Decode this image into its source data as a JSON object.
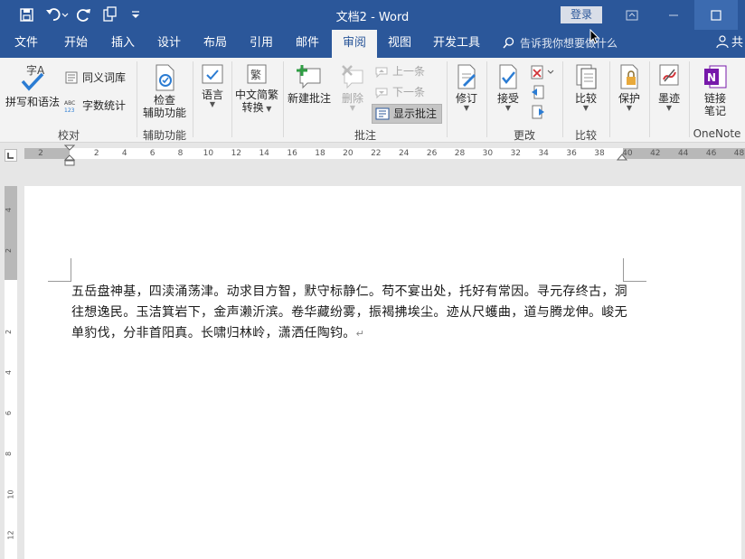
{
  "titlebar": {
    "title": "文档2  -  Word",
    "login": "登录",
    "qat": [
      "save-icon",
      "undo-icon",
      "redo-icon",
      "touch-mode-icon",
      "customize-qat-icon"
    ]
  },
  "tabs": [
    {
      "label": "文件"
    },
    {
      "label": "开始"
    },
    {
      "label": "插入"
    },
    {
      "label": "设计"
    },
    {
      "label": "布局"
    },
    {
      "label": "引用"
    },
    {
      "label": "邮件"
    },
    {
      "label": "审阅"
    },
    {
      "label": "视图"
    },
    {
      "label": "开发工具"
    }
  ],
  "tell_me": "告诉我你想要做什么",
  "share": "共",
  "ribbon": {
    "proofing": {
      "spelling": "拼写和语法",
      "thesaurus": "同义词库",
      "word_count": "字数统计",
      "group": "校对"
    },
    "accessibility": {
      "check_line1": "检查",
      "check_line2": "辅助功能",
      "group": "辅助功能"
    },
    "language": {
      "label": "语言"
    },
    "chinese": {
      "line1": "中文简繁",
      "line2": "转换"
    },
    "comments": {
      "new": "新建批注",
      "delete": "删除",
      "previous": "上一条",
      "next": "下一条",
      "show": "显示批注",
      "group": "批注"
    },
    "tracking": {
      "label": "修订"
    },
    "changes": {
      "accept": "接受",
      "group": "更改"
    },
    "compare": {
      "label": "比较",
      "group": "比较"
    },
    "protect": {
      "label": "保护"
    },
    "ink": {
      "label": "墨迹"
    },
    "onenote": {
      "line1": "链接",
      "line2": "笔记",
      "group": "OneNote"
    }
  },
  "ruler": {
    "h_ticks": [
      "2",
      "",
      "2",
      "4",
      "6",
      "8",
      "10",
      "12",
      "14",
      "16",
      "18",
      "20",
      "22",
      "24",
      "26",
      "28",
      "30",
      "32",
      "34",
      "36",
      "38",
      "40",
      "42",
      "44",
      "46",
      "48"
    ],
    "v_ticks": [
      "4",
      "2",
      "",
      "2",
      "4",
      "6",
      "8",
      "10",
      "12"
    ]
  },
  "document": {
    "paragraph": "五岳盘神基，四渎涌荡津。动求目方智，默守标静仁。苟不宴出处，托好有常因。寻元存终古，洞往想逸民。玉洁箕岩下，金声濑沂滨。卷华藏纷雾，振褐拂埃尘。迹从尺蠖曲，道与腾龙伸。峻无单豹伐，分非首阳真。长啸归林岭，潇洒任陶钧。",
    "para_mark": "↵"
  },
  "colors": {
    "accent": "#2b579a",
    "ribbon_bg": "#f3f3f3",
    "onenote": "#7719aa"
  }
}
